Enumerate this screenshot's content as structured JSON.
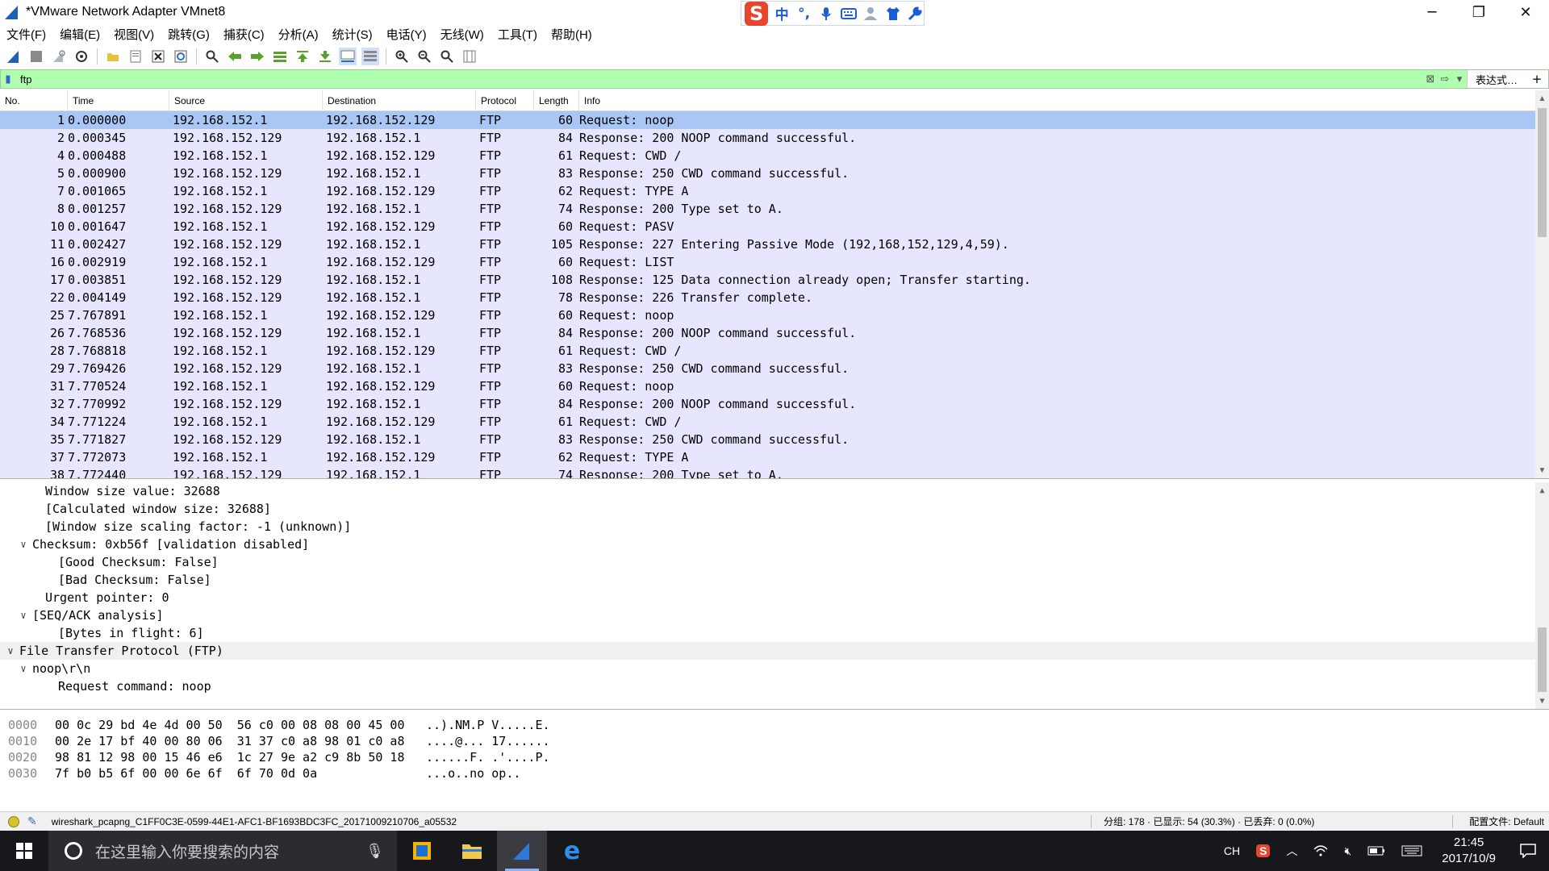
{
  "window": {
    "title": "*VMware Network Adapter VMnet8",
    "controls": {
      "minimize": "─",
      "maximize": "❐",
      "close": "✕"
    }
  },
  "ime_bar": {
    "logo": "S",
    "items": [
      "中",
      "°,",
      "🎤",
      "⌨",
      "👕",
      "🔧"
    ]
  },
  "menu": [
    "文件(F)",
    "编辑(E)",
    "视图(V)",
    "跳转(G)",
    "捕获(C)",
    "分析(A)",
    "统计(S)",
    "电话(Y)",
    "无线(W)",
    "工具(T)",
    "帮助(H)"
  ],
  "toolbar": {
    "icons": [
      "shark-fin-start-icon",
      "stop-icon",
      "restart-icon",
      "options-gear-icon",
      "open-file-icon",
      "save-file-icon",
      "close-file-icon",
      "reload-icon",
      "find-icon",
      "back-arrow-icon",
      "forward-arrow-icon",
      "goto-packet-icon",
      "first-packet-icon",
      "last-packet-icon",
      "autoscroll-icon",
      "colorize-icon",
      "zoom-in-icon",
      "zoom-out-icon",
      "zoom-reset-icon",
      "resize-columns-icon"
    ]
  },
  "filter": {
    "value": "ftp",
    "expression_label": "表达式…",
    "plus": "+"
  },
  "packet_list": {
    "columns": [
      "No.",
      "Time",
      "Source",
      "Destination",
      "Protocol",
      "Length",
      "Info"
    ],
    "rows": [
      {
        "no": "1",
        "time": "0.000000",
        "src": "192.168.152.1",
        "dst": "192.168.152.129",
        "proto": "FTP",
        "len": "60",
        "info": "Request: noop"
      },
      {
        "no": "2",
        "time": "0.000345",
        "src": "192.168.152.129",
        "dst": "192.168.152.1",
        "proto": "FTP",
        "len": "84",
        "info": "Response: 200 NOOP command successful."
      },
      {
        "no": "4",
        "time": "0.000488",
        "src": "192.168.152.1",
        "dst": "192.168.152.129",
        "proto": "FTP",
        "len": "61",
        "info": "Request: CWD /"
      },
      {
        "no": "5",
        "time": "0.000900",
        "src": "192.168.152.129",
        "dst": "192.168.152.1",
        "proto": "FTP",
        "len": "83",
        "info": "Response: 250 CWD command successful."
      },
      {
        "no": "7",
        "time": "0.001065",
        "src": "192.168.152.1",
        "dst": "192.168.152.129",
        "proto": "FTP",
        "len": "62",
        "info": "Request: TYPE A"
      },
      {
        "no": "8",
        "time": "0.001257",
        "src": "192.168.152.129",
        "dst": "192.168.152.1",
        "proto": "FTP",
        "len": "74",
        "info": "Response: 200 Type set to A."
      },
      {
        "no": "10",
        "time": "0.001647",
        "src": "192.168.152.1",
        "dst": "192.168.152.129",
        "proto": "FTP",
        "len": "60",
        "info": "Request: PASV"
      },
      {
        "no": "11",
        "time": "0.002427",
        "src": "192.168.152.129",
        "dst": "192.168.152.1",
        "proto": "FTP",
        "len": "105",
        "info": "Response: 227 Entering Passive Mode (192,168,152,129,4,59)."
      },
      {
        "no": "16",
        "time": "0.002919",
        "src": "192.168.152.1",
        "dst": "192.168.152.129",
        "proto": "FTP",
        "len": "60",
        "info": "Request: LIST"
      },
      {
        "no": "17",
        "time": "0.003851",
        "src": "192.168.152.129",
        "dst": "192.168.152.1",
        "proto": "FTP",
        "len": "108",
        "info": "Response: 125 Data connection already open; Transfer starting."
      },
      {
        "no": "22",
        "time": "0.004149",
        "src": "192.168.152.129",
        "dst": "192.168.152.1",
        "proto": "FTP",
        "len": "78",
        "info": "Response: 226 Transfer complete."
      },
      {
        "no": "25",
        "time": "7.767891",
        "src": "192.168.152.1",
        "dst": "192.168.152.129",
        "proto": "FTP",
        "len": "60",
        "info": "Request: noop"
      },
      {
        "no": "26",
        "time": "7.768536",
        "src": "192.168.152.129",
        "dst": "192.168.152.1",
        "proto": "FTP",
        "len": "84",
        "info": "Response: 200 NOOP command successful."
      },
      {
        "no": "28",
        "time": "7.768818",
        "src": "192.168.152.1",
        "dst": "192.168.152.129",
        "proto": "FTP",
        "len": "61",
        "info": "Request: CWD /"
      },
      {
        "no": "29",
        "time": "7.769426",
        "src": "192.168.152.129",
        "dst": "192.168.152.1",
        "proto": "FTP",
        "len": "83",
        "info": "Response: 250 CWD command successful."
      },
      {
        "no": "31",
        "time": "7.770524",
        "src": "192.168.152.1",
        "dst": "192.168.152.129",
        "proto": "FTP",
        "len": "60",
        "info": "Request: noop"
      },
      {
        "no": "32",
        "time": "7.770992",
        "src": "192.168.152.129",
        "dst": "192.168.152.1",
        "proto": "FTP",
        "len": "84",
        "info": "Response: 200 NOOP command successful."
      },
      {
        "no": "34",
        "time": "7.771224",
        "src": "192.168.152.1",
        "dst": "192.168.152.129",
        "proto": "FTP",
        "len": "61",
        "info": "Request: CWD /"
      },
      {
        "no": "35",
        "time": "7.771827",
        "src": "192.168.152.129",
        "dst": "192.168.152.1",
        "proto": "FTP",
        "len": "83",
        "info": "Response: 250 CWD command successful."
      },
      {
        "no": "37",
        "time": "7.772073",
        "src": "192.168.152.1",
        "dst": "192.168.152.129",
        "proto": "FTP",
        "len": "62",
        "info": "Request: TYPE A"
      },
      {
        "no": "38",
        "time": "7.772440",
        "src": "192.168.152.129",
        "dst": "192.168.152.1",
        "proto": "FTP",
        "len": "74",
        "info": "Response: 200 Type set to A."
      }
    ],
    "selected_index": 0
  },
  "details": [
    {
      "indent": 2,
      "toggle": "",
      "text": "Window size value: 32688"
    },
    {
      "indent": 2,
      "toggle": "",
      "text": "[Calculated window size: 32688]"
    },
    {
      "indent": 2,
      "toggle": "",
      "text": "[Window size scaling factor: -1 (unknown)]"
    },
    {
      "indent": 1,
      "toggle": "∨",
      "text": "Checksum: 0xb56f [validation disabled]"
    },
    {
      "indent": 3,
      "toggle": "",
      "text": "[Good Checksum: False]"
    },
    {
      "indent": 3,
      "toggle": "",
      "text": "[Bad Checksum: False]"
    },
    {
      "indent": 2,
      "toggle": "",
      "text": "Urgent pointer: 0"
    },
    {
      "indent": 1,
      "toggle": "∨",
      "text": "[SEQ/ACK analysis]"
    },
    {
      "indent": 3,
      "toggle": "",
      "text": "[Bytes in flight: 6]"
    },
    {
      "indent": 0,
      "toggle": "∨",
      "text": "File Transfer Protocol (FTP)",
      "highlight": true
    },
    {
      "indent": 1,
      "toggle": "∨",
      "text": "noop\\r\\n"
    },
    {
      "indent": 3,
      "toggle": "",
      "text": "Request command: noop"
    }
  ],
  "bytes": [
    {
      "offset": "0000",
      "hex": "00 0c 29 bd 4e 4d 00 50  56 c0 00 08 08 00 45 00",
      "ascii": "..).NM.P V.....E."
    },
    {
      "offset": "0010",
      "hex": "00 2e 17 bf 40 00 80 06  31 37 c0 a8 98 01 c0 a8",
      "ascii": "....@... 17......"
    },
    {
      "offset": "0020",
      "hex": "98 81 12 98 00 15 46 e6  1c 27 9e a2 c9 8b 50 18",
      "ascii": "......F. .'....P."
    },
    {
      "offset": "0030",
      "hex": "7f b0 b5 6f 00 00 6e 6f  6f 70 0d 0a",
      "ascii": "...o..no op.."
    }
  ],
  "status": {
    "file": "wireshark_pcapng_C1FF0C3E-0599-44E1-AFC1-BF1693BDC3FC_20171009210706_a05532",
    "stats": "分组: 178 · 已显示: 54 (30.3%) · 已丢弃: 0 (0.0%)",
    "profile": "配置文件: Default"
  },
  "taskbar": {
    "search_placeholder": "在这里输入你要搜索的内容",
    "tray_lang": "CH",
    "time": "21:45",
    "date": "2017/10/9"
  }
}
